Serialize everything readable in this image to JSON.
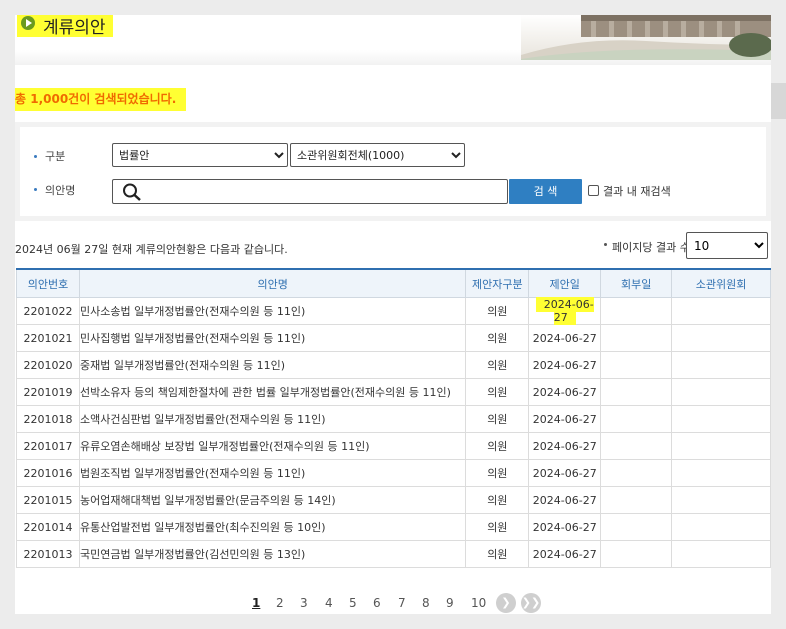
{
  "header": {
    "title": "계류의안"
  },
  "summary": {
    "text": "총 1,000건이 검색되었습니다."
  },
  "search": {
    "category_label": "구분",
    "category_selected": "법률안",
    "committee_selected": "소관위원회전체(1000)",
    "bill_name_label": "의안명",
    "query_value": "",
    "search_button": "검 색",
    "research_label": "결과 내 재검색"
  },
  "status": {
    "date_line": "2024년 06월 27일 현재 계류의안현황은 다음과 같습니다.",
    "per_page_label": "페이지당 결과 수",
    "per_page_value": "10"
  },
  "table": {
    "headers": [
      "의안번호",
      "의안명",
      "제안자구분",
      "제안일",
      "회부일",
      "소관위원회"
    ],
    "rows": [
      {
        "no": "2201022",
        "name": "민사소송법 일부개정법률안(전재수의원 등 11인)",
        "proposer": "의원",
        "date": "2024-06-27",
        "refer": "",
        "committee": ""
      },
      {
        "no": "2201021",
        "name": "민사집행법 일부개정법률안(전재수의원 등 11인)",
        "proposer": "의원",
        "date": "2024-06-27",
        "refer": "",
        "committee": ""
      },
      {
        "no": "2201020",
        "name": "중재법 일부개정법률안(전재수의원 등 11인)",
        "proposer": "의원",
        "date": "2024-06-27",
        "refer": "",
        "committee": ""
      },
      {
        "no": "2201019",
        "name": "선박소유자 등의 책임제한절차에 관한 법률 일부개정법률안(전재수의원 등 11인)",
        "proposer": "의원",
        "date": "2024-06-27",
        "refer": "",
        "committee": ""
      },
      {
        "no": "2201018",
        "name": "소액사건심판법 일부개정법률안(전재수의원 등 11인)",
        "proposer": "의원",
        "date": "2024-06-27",
        "refer": "",
        "committee": ""
      },
      {
        "no": "2201017",
        "name": "유류오염손해배상 보장법 일부개정법률안(전재수의원 등 11인)",
        "proposer": "의원",
        "date": "2024-06-27",
        "refer": "",
        "committee": ""
      },
      {
        "no": "2201016",
        "name": "법원조직법 일부개정법률안(전재수의원 등 11인)",
        "proposer": "의원",
        "date": "2024-06-27",
        "refer": "",
        "committee": ""
      },
      {
        "no": "2201015",
        "name": "농어업재해대책법 일부개정법률안(문금주의원 등 14인)",
        "proposer": "의원",
        "date": "2024-06-27",
        "refer": "",
        "committee": ""
      },
      {
        "no": "2201014",
        "name": "유통산업발전법 일부개정법률안(최수진의원 등 10인)",
        "proposer": "의원",
        "date": "2024-06-27",
        "refer": "",
        "committee": ""
      },
      {
        "no": "2201013",
        "name": "국민연금법 일부개정법률안(김선민의원 등 13인)",
        "proposer": "의원",
        "date": "2024-06-27",
        "refer": "",
        "committee": ""
      }
    ]
  },
  "pagination": {
    "pages": [
      "1",
      "2",
      "3",
      "4",
      "5",
      "6",
      "7",
      "8",
      "9",
      "10"
    ],
    "current": "1",
    "next_icon": "chevron-right-icon",
    "last_icon": "double-chevron-right-icon"
  },
  "colors": {
    "accent_blue": "#2f7fc2",
    "summary_orange": "#f06a00",
    "highlight_yellow": "#ffff33"
  }
}
